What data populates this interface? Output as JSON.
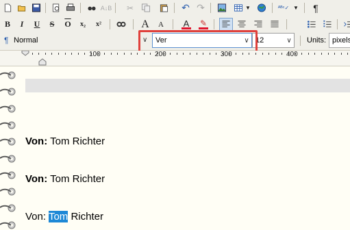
{
  "toolbar1": {
    "items": [
      "new-icon",
      "open-icon",
      "save-icon",
      "print-preview-icon",
      "print-icon",
      "find-icon",
      "find-replace-icon",
      "cut-icon",
      "copy-icon",
      "paste-icon",
      "undo-icon",
      "redo-icon",
      "insert-image-icon",
      "insert-table-icon",
      "insert-link-icon",
      "spellcheck-icon",
      "pilcrow-icon"
    ]
  },
  "toolbar2": {
    "bold": "B",
    "italic": "I",
    "underline": "U",
    "strike": "S",
    "overline": "O",
    "subscript": "x₂",
    "superscript": "x²",
    "grow_font": "A",
    "shrink_font": "A"
  },
  "format_bar": {
    "paragraph_mark": "¶",
    "style_value": "Normal",
    "font_value": "Ver",
    "size_value": "12",
    "units_label": "Units:",
    "units_value": "pixels"
  },
  "ruler": {
    "labels": [
      "100",
      "200",
      "300",
      "400"
    ]
  },
  "document": {
    "lines": [
      {
        "bold": "Von:",
        "rest": "Tom Richter"
      },
      {
        "bold": "Von:",
        "rest": "Tom Richter"
      }
    ],
    "last_line": {
      "prefix": "Von: ",
      "selected": "Tom",
      "suffix": " Richter"
    }
  },
  "colors": {
    "highlight_box": "#e0413c",
    "selection": "#1e88d6",
    "font_color_bar": "#e0152d"
  }
}
